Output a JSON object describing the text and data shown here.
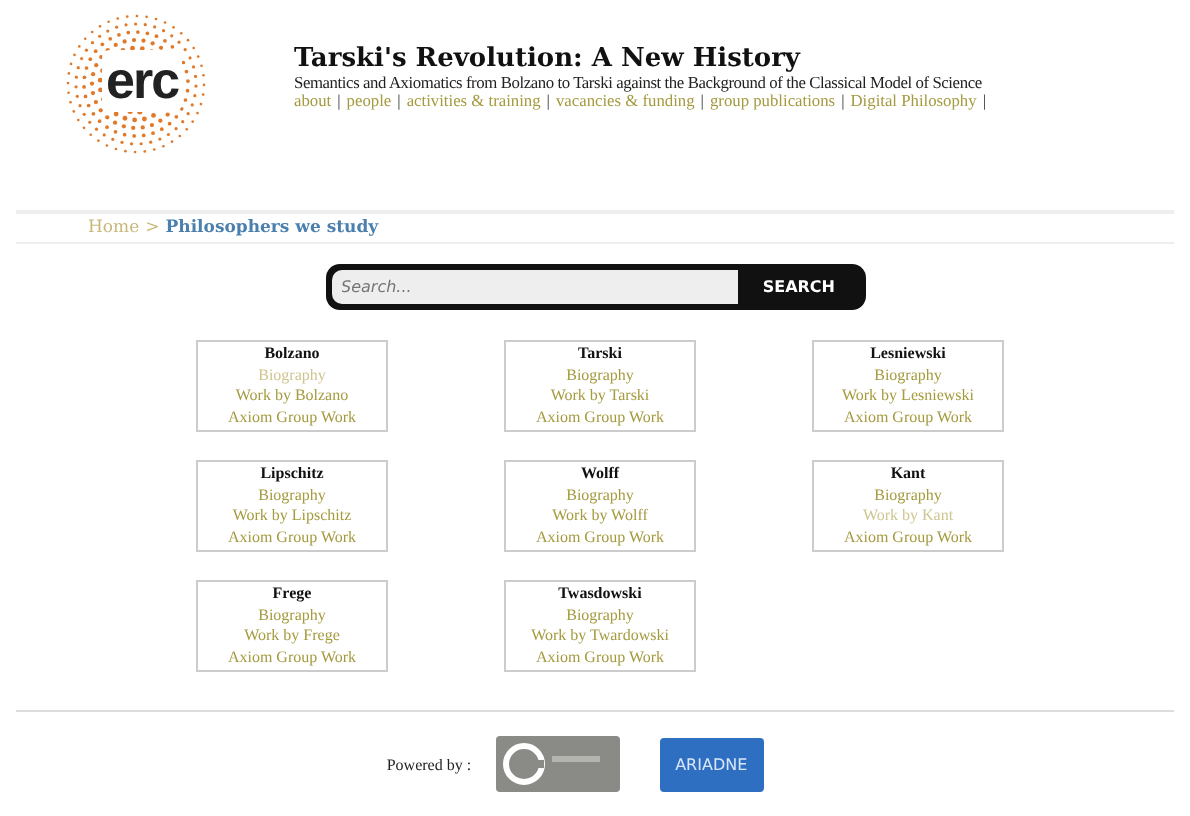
{
  "header": {
    "logo": "erc",
    "title": "Tarski's Revolution: A New History",
    "subtitle": "Semantics and Axiomatics from Bolzano to Tarski against the Background of the Classical Model of Science",
    "nav_separator": "|",
    "nav": [
      "about",
      "people",
      "activities & training",
      "vacancies & funding",
      "group publications",
      "Digital Philosophy"
    ]
  },
  "breadcrumb_separator": ">",
  "breadcrumb": [
    {
      "label": "Home",
      "current": false
    },
    {
      "label": "Philosophers we study",
      "current": true
    }
  ],
  "search": {
    "placeholder": "Search...",
    "button": "SEARCH"
  },
  "philosophers": [
    {
      "name": "Bolzano",
      "links": [
        {
          "label": "Biography",
          "visited": true
        },
        {
          "label": "Work by Bolzano",
          "visited": false
        },
        {
          "label": "Axiom Group Work",
          "visited": false
        }
      ]
    },
    {
      "name": "Tarski",
      "links": [
        {
          "label": "Biography",
          "visited": false
        },
        {
          "label": "Work by Tarski",
          "visited": false
        },
        {
          "label": "Axiom Group Work",
          "visited": false
        }
      ]
    },
    {
      "name": "Lesniewski",
      "links": [
        {
          "label": "Biography",
          "visited": false
        },
        {
          "label": "Work by Lesniewski",
          "visited": false
        },
        {
          "label": "Axiom Group Work",
          "visited": false
        }
      ]
    },
    {
      "name": "Lipschitz",
      "links": [
        {
          "label": "Biography",
          "visited": false
        },
        {
          "label": "Work by Lipschitz",
          "visited": false
        },
        {
          "label": "Axiom Group Work",
          "visited": false
        }
      ]
    },
    {
      "name": "Wolff",
      "links": [
        {
          "label": "Biography",
          "visited": false
        },
        {
          "label": "Work by Wolff",
          "visited": false
        },
        {
          "label": "Axiom Group Work",
          "visited": false
        }
      ]
    },
    {
      "name": "Kant",
      "links": [
        {
          "label": "Biography",
          "visited": false
        },
        {
          "label": "Work by Kant",
          "visited": true
        },
        {
          "label": "Axiom Group Work",
          "visited": false
        }
      ]
    },
    {
      "name": "Frege",
      "links": [
        {
          "label": "Biography",
          "visited": false
        },
        {
          "label": "Work by Frege",
          "visited": false
        },
        {
          "label": "Axiom Group Work",
          "visited": false
        }
      ]
    },
    {
      "name": "Twasdowski",
      "links": [
        {
          "label": "Biography",
          "visited": false
        },
        {
          "label": "Work by Twardowski",
          "visited": false
        },
        {
          "label": "Axiom Group Work",
          "visited": false
        }
      ]
    }
  ],
  "footer": {
    "powered_by": "Powered by :",
    "partner_logo": "ARIADNE"
  }
}
